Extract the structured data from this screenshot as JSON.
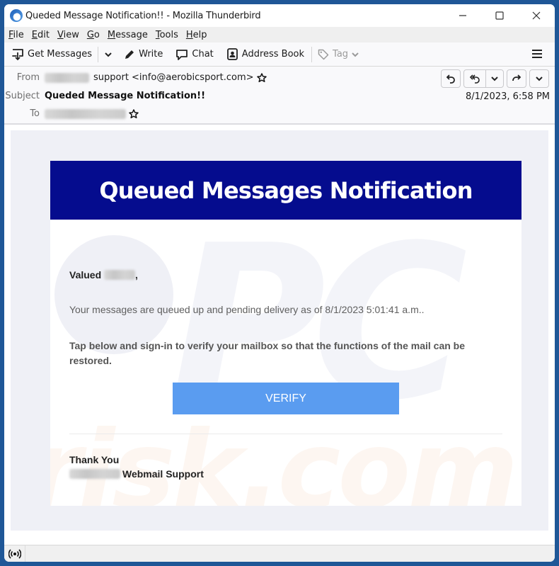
{
  "window": {
    "title": "Queded Message Notification!! - Mozilla Thunderbird",
    "controls": [
      "minimize",
      "maximize",
      "close"
    ]
  },
  "menubar": {
    "items": [
      {
        "label": "File",
        "accel": "F",
        "rest": "ile"
      },
      {
        "label": "Edit",
        "accel": "E",
        "rest": "dit"
      },
      {
        "label": "View",
        "accel": "V",
        "rest": "iew"
      },
      {
        "label": "Go",
        "accel": "G",
        "rest": "o"
      },
      {
        "label": "Message",
        "accel": "M",
        "rest": "essage"
      },
      {
        "label": "Tools",
        "accel": "T",
        "rest": "ools"
      },
      {
        "label": "Help",
        "accel": "H",
        "rest": "elp"
      }
    ]
  },
  "toolbar": {
    "get_messages": "Get Messages",
    "write": "Write",
    "chat": "Chat",
    "address_book": "Address Book",
    "tag": "Tag"
  },
  "header": {
    "from_label": "From",
    "from_sender": "support <info@aerobicsport.com>",
    "subject_label": "Subject",
    "subject": "Queded Message Notification!!",
    "to_label": "To",
    "date": "8/1/2023, 6:58 PM"
  },
  "email": {
    "banner_title": "Queued Messages Notification",
    "salutation": "Valued",
    "salutation_suffix": ",",
    "paragraph1": "Your messages are queued up and pending delivery as of 8/1/2023 5:01:41 a.m..",
    "paragraph2": "Tap below and sign-in to verify your mailbox so that the functions of the mail can be restored.",
    "verify_button": "VERIFY",
    "thanks": "Thank You",
    "signoff": "Webmail Support",
    "watermark": "risk.com",
    "watermark_pc": "PC"
  },
  "colors": {
    "banner": "#050c8e",
    "button": "#5a9cf0",
    "window_frame": "#1f5797"
  }
}
